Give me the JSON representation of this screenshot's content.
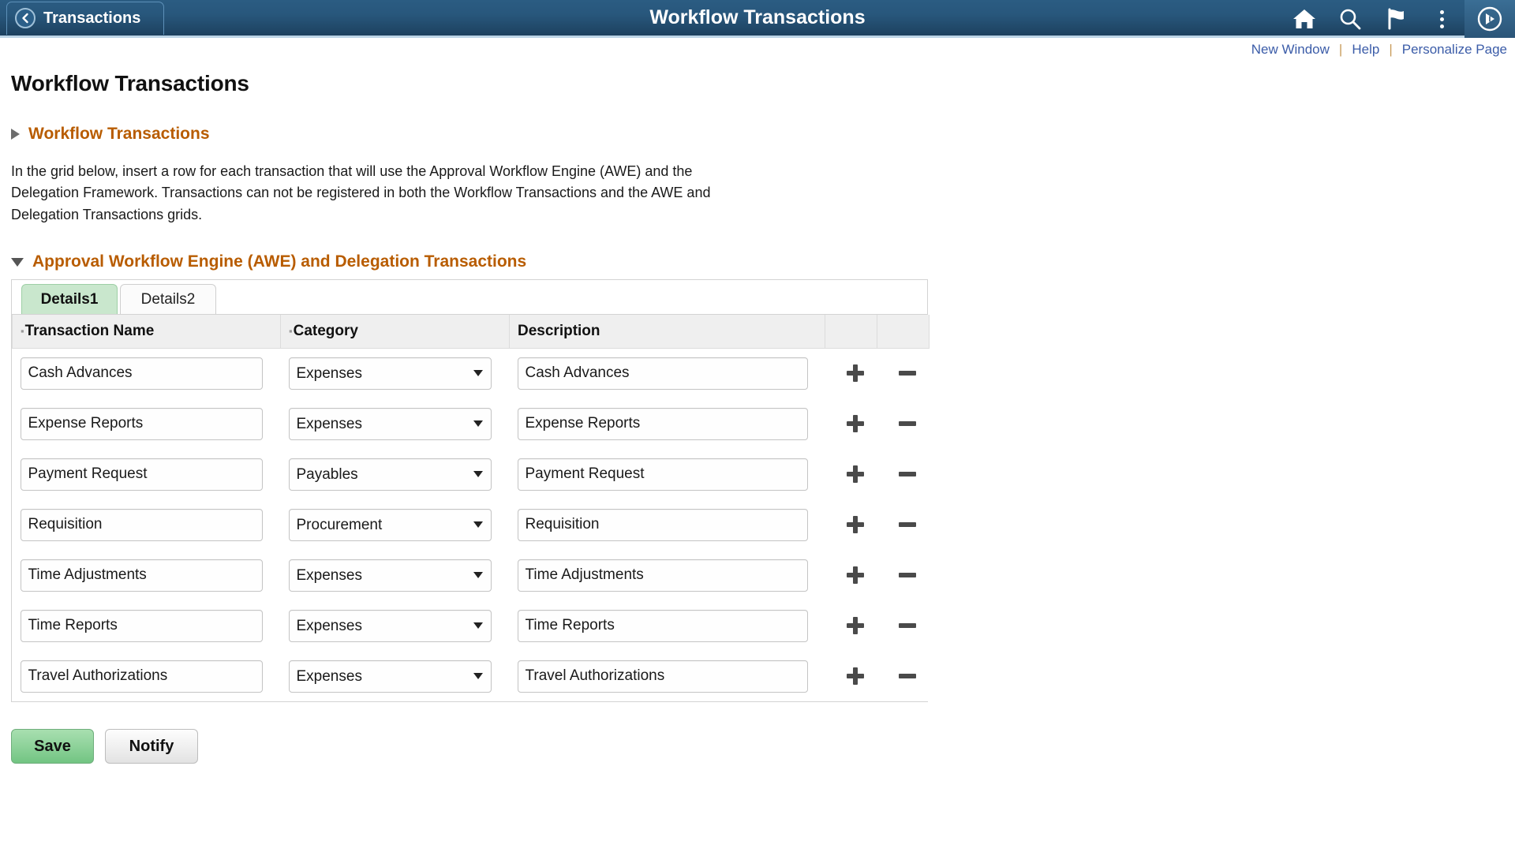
{
  "header": {
    "back_label": "Transactions",
    "title": "Workflow Transactions",
    "icons": [
      {
        "name": "home-icon",
        "label": "Home"
      },
      {
        "name": "search-icon",
        "label": "Search"
      },
      {
        "name": "flag-icon",
        "label": "Notifications"
      },
      {
        "name": "three-dot-menu-icon",
        "label": "Actions"
      },
      {
        "name": "navbar-compass-icon",
        "label": "NavBar"
      }
    ]
  },
  "utility_links": {
    "new_window": "New Window",
    "help": "Help",
    "personalize_page": "Personalize Page",
    "separator": "|"
  },
  "page": {
    "title": "Workflow Transactions",
    "workflow_section_label": "Workflow Transactions",
    "workflow_section_expanded": false,
    "intro_paragraph": "In the grid below, insert a row for each transaction that will use the Approval Workflow Engine (AWE) and the\nDelegation Framework. Transactions can not be registered in both the Workflow Transactions and the AWE and\nDelegation Transactions grids.",
    "awe_section_label": "Approval Workflow Engine (AWE) and Delegation Transactions",
    "awe_section_expanded": true
  },
  "grid": {
    "tabs": [
      {
        "label": "Details1",
        "active": true
      },
      {
        "label": "Details2",
        "active": false
      }
    ],
    "columns": [
      {
        "label": "Transaction Name",
        "required": true
      },
      {
        "label": "Category",
        "required": true
      },
      {
        "label": "Description",
        "required": false
      },
      {
        "label": "",
        "required": false
      },
      {
        "label": "",
        "required": false
      }
    ],
    "category_options": [
      "Expenses",
      "Payables",
      "Procurement"
    ],
    "add_row_label": "+",
    "delete_row_label": "−",
    "rows": [
      {
        "transaction_name": "Cash Advances",
        "category": "Expenses",
        "description": "Cash Advances"
      },
      {
        "transaction_name": "Expense Reports",
        "category": "Expenses",
        "description": "Expense Reports"
      },
      {
        "transaction_name": "Payment Request",
        "category": "Payables",
        "description": "Payment Request"
      },
      {
        "transaction_name": "Requisition",
        "category": "Procurement",
        "description": "Requisition"
      },
      {
        "transaction_name": "Time Adjustments",
        "category": "Expenses",
        "description": "Time Adjustments"
      },
      {
        "transaction_name": "Time Reports",
        "category": "Expenses",
        "description": "Time Reports"
      },
      {
        "transaction_name": "Travel Authorizations",
        "category": "Expenses",
        "description": "Travel Authorizations"
      }
    ]
  },
  "footer": {
    "save_label": "Save",
    "notify_label": "Notify"
  },
  "colors": {
    "header_blue": "#28577c",
    "link_blue": "#3b5ca8",
    "section_orange": "#b85c00",
    "tab_active_green": "#c9e7cd",
    "save_green": "#8ed29a"
  }
}
